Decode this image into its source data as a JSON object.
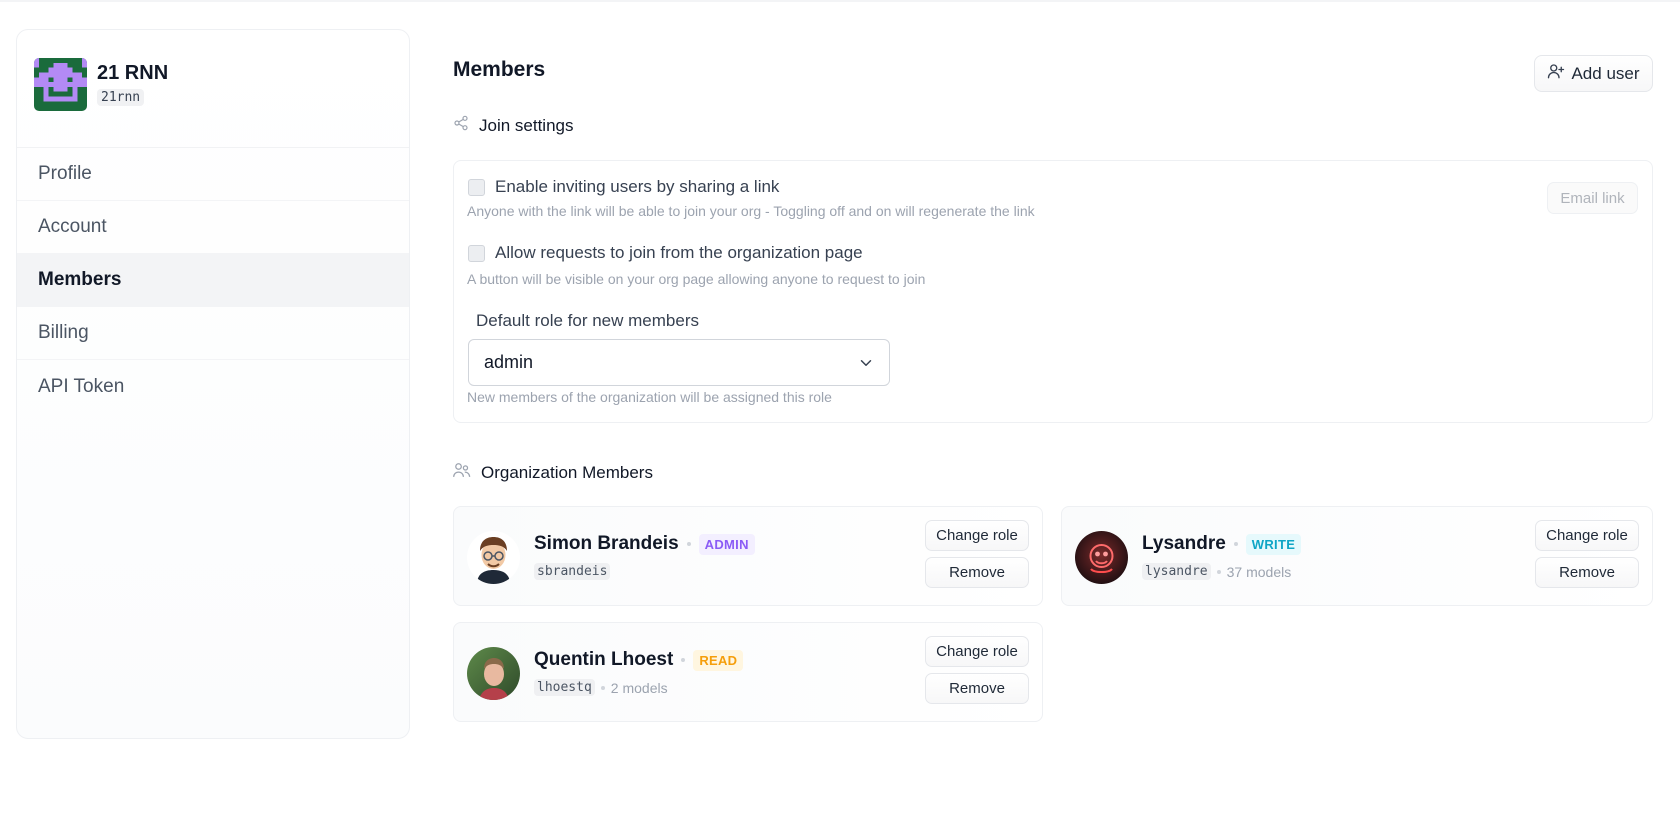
{
  "org": {
    "name": "21 RNN",
    "handle": "21rnn",
    "avatar_icon": "space-invader-icon",
    "avatar_colors": {
      "background": "#1a6b3c",
      "figure": "#b38af5"
    }
  },
  "sidebar": {
    "items": [
      {
        "label": "Profile",
        "active": false
      },
      {
        "label": "Account",
        "active": false
      },
      {
        "label": "Members",
        "active": true
      },
      {
        "label": "Billing",
        "active": false
      },
      {
        "label": "API Token",
        "active": false
      }
    ]
  },
  "header": {
    "title": "Members",
    "add_user_label": "Add user",
    "add_user_icon": "user-plus-icon"
  },
  "join_settings": {
    "title": "Join settings",
    "icon": "share-icon",
    "invite_link": {
      "label": "Enable inviting users by sharing a link",
      "hint": "Anyone with the link will be able to join your org - Toggling off and on will regenerate the link",
      "checked": false,
      "email_link_label": "Email link"
    },
    "requests": {
      "label": "Allow requests to join from the organization page",
      "hint": "A button will be visible on your org page allowing anyone to request to join",
      "checked": false
    },
    "default_role": {
      "label": "Default role for new members",
      "value": "admin",
      "hint": "New members of the organization will be assigned this role"
    }
  },
  "members_section": {
    "title": "Organization Members",
    "icon": "users-icon",
    "change_role_label": "Change role",
    "remove_label": "Remove",
    "members": [
      {
        "name": "Simon Brandeis",
        "role": "ADMIN",
        "handle": "sbrandeis",
        "models": "",
        "avatar": "cartoon-avatar"
      },
      {
        "name": "Lysandre",
        "role": "WRITE",
        "handle": "lysandre",
        "models": "37 models",
        "avatar": "neon-avatar"
      },
      {
        "name": "Quentin Lhoest",
        "role": "READ",
        "handle": "lhoestq",
        "models": "2 models",
        "avatar": "photo-avatar"
      }
    ]
  },
  "colors": {
    "admin_badge": "#8b5cf6",
    "write_badge": "#0ea5c6",
    "read_badge": "#f59e0b"
  }
}
